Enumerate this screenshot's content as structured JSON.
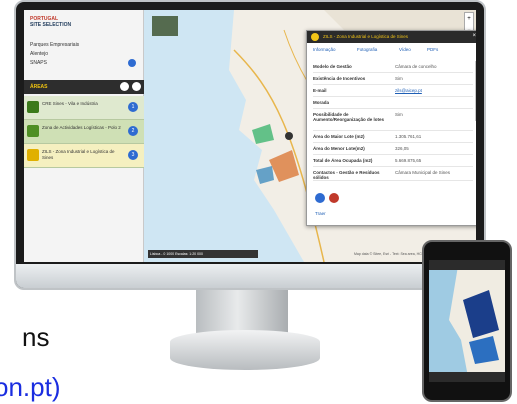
{
  "sidebar": {
    "brand_line1": "PORTUGAL",
    "brand_line2": "SITE SELECTION",
    "lines": [
      "Parques Empresariais",
      "Alentejo",
      "SNAPS"
    ],
    "nav_label": "ÁREAS",
    "items": [
      {
        "label": "CRE Sines - Vila e Indústria",
        "badge": "1",
        "color": "#3b7a1a"
      },
      {
        "label": "Zona de Actividades Logísticas - Polo 2",
        "badge": "2",
        "color": "#4f8f24"
      },
      {
        "label": "ZILS - Zona Industrial e Logística de Sines",
        "badge": "3",
        "color": "#e0b000"
      }
    ]
  },
  "popup": {
    "title": "ZILS - Zona Industrial e Logística de Sines",
    "tabs": [
      "Informação",
      "Fotografia",
      "Vídeo",
      "PDFs"
    ],
    "rows": [
      {
        "k": "Modelo de Gestão",
        "v": "Câmara de concelho"
      },
      {
        "k": "Existência de Incentivos",
        "v": "Sim"
      },
      {
        "k": "E-mail",
        "v": "zils@aicep.pt"
      },
      {
        "k": "Morada",
        "v": ""
      },
      {
        "k": "Possibilidade de Aumento/Reorganização de lotes",
        "v": "Sim"
      },
      {
        "k": "Área do Maior Lote (m2)",
        "v": "1.305.761,61"
      },
      {
        "k": "Área do Menor Lote(m2)",
        "v": "326,05"
      },
      {
        "k": "Total de Área Ocupada (m2)",
        "v": "5.669.875,65"
      },
      {
        "k": "Contactos - Gestão e Resíduos sólidos",
        "v": "Câmara Municipal de Sines"
      }
    ],
    "footer": "Traer"
  },
  "map": {
    "scale_text": "Lisboa - 0 1000  Escalas: 1:20 000",
    "attribution": "Map data © Sitee, Esri - Text: Sea area, HCFA"
  },
  "caption": {
    "line1": "ns",
    "line2": "on.pt)"
  },
  "colors": {
    "sea": "#cfe6f3",
    "land": "#f2eee6",
    "accent": "#2e6bd1",
    "brand": "#c0392b"
  }
}
